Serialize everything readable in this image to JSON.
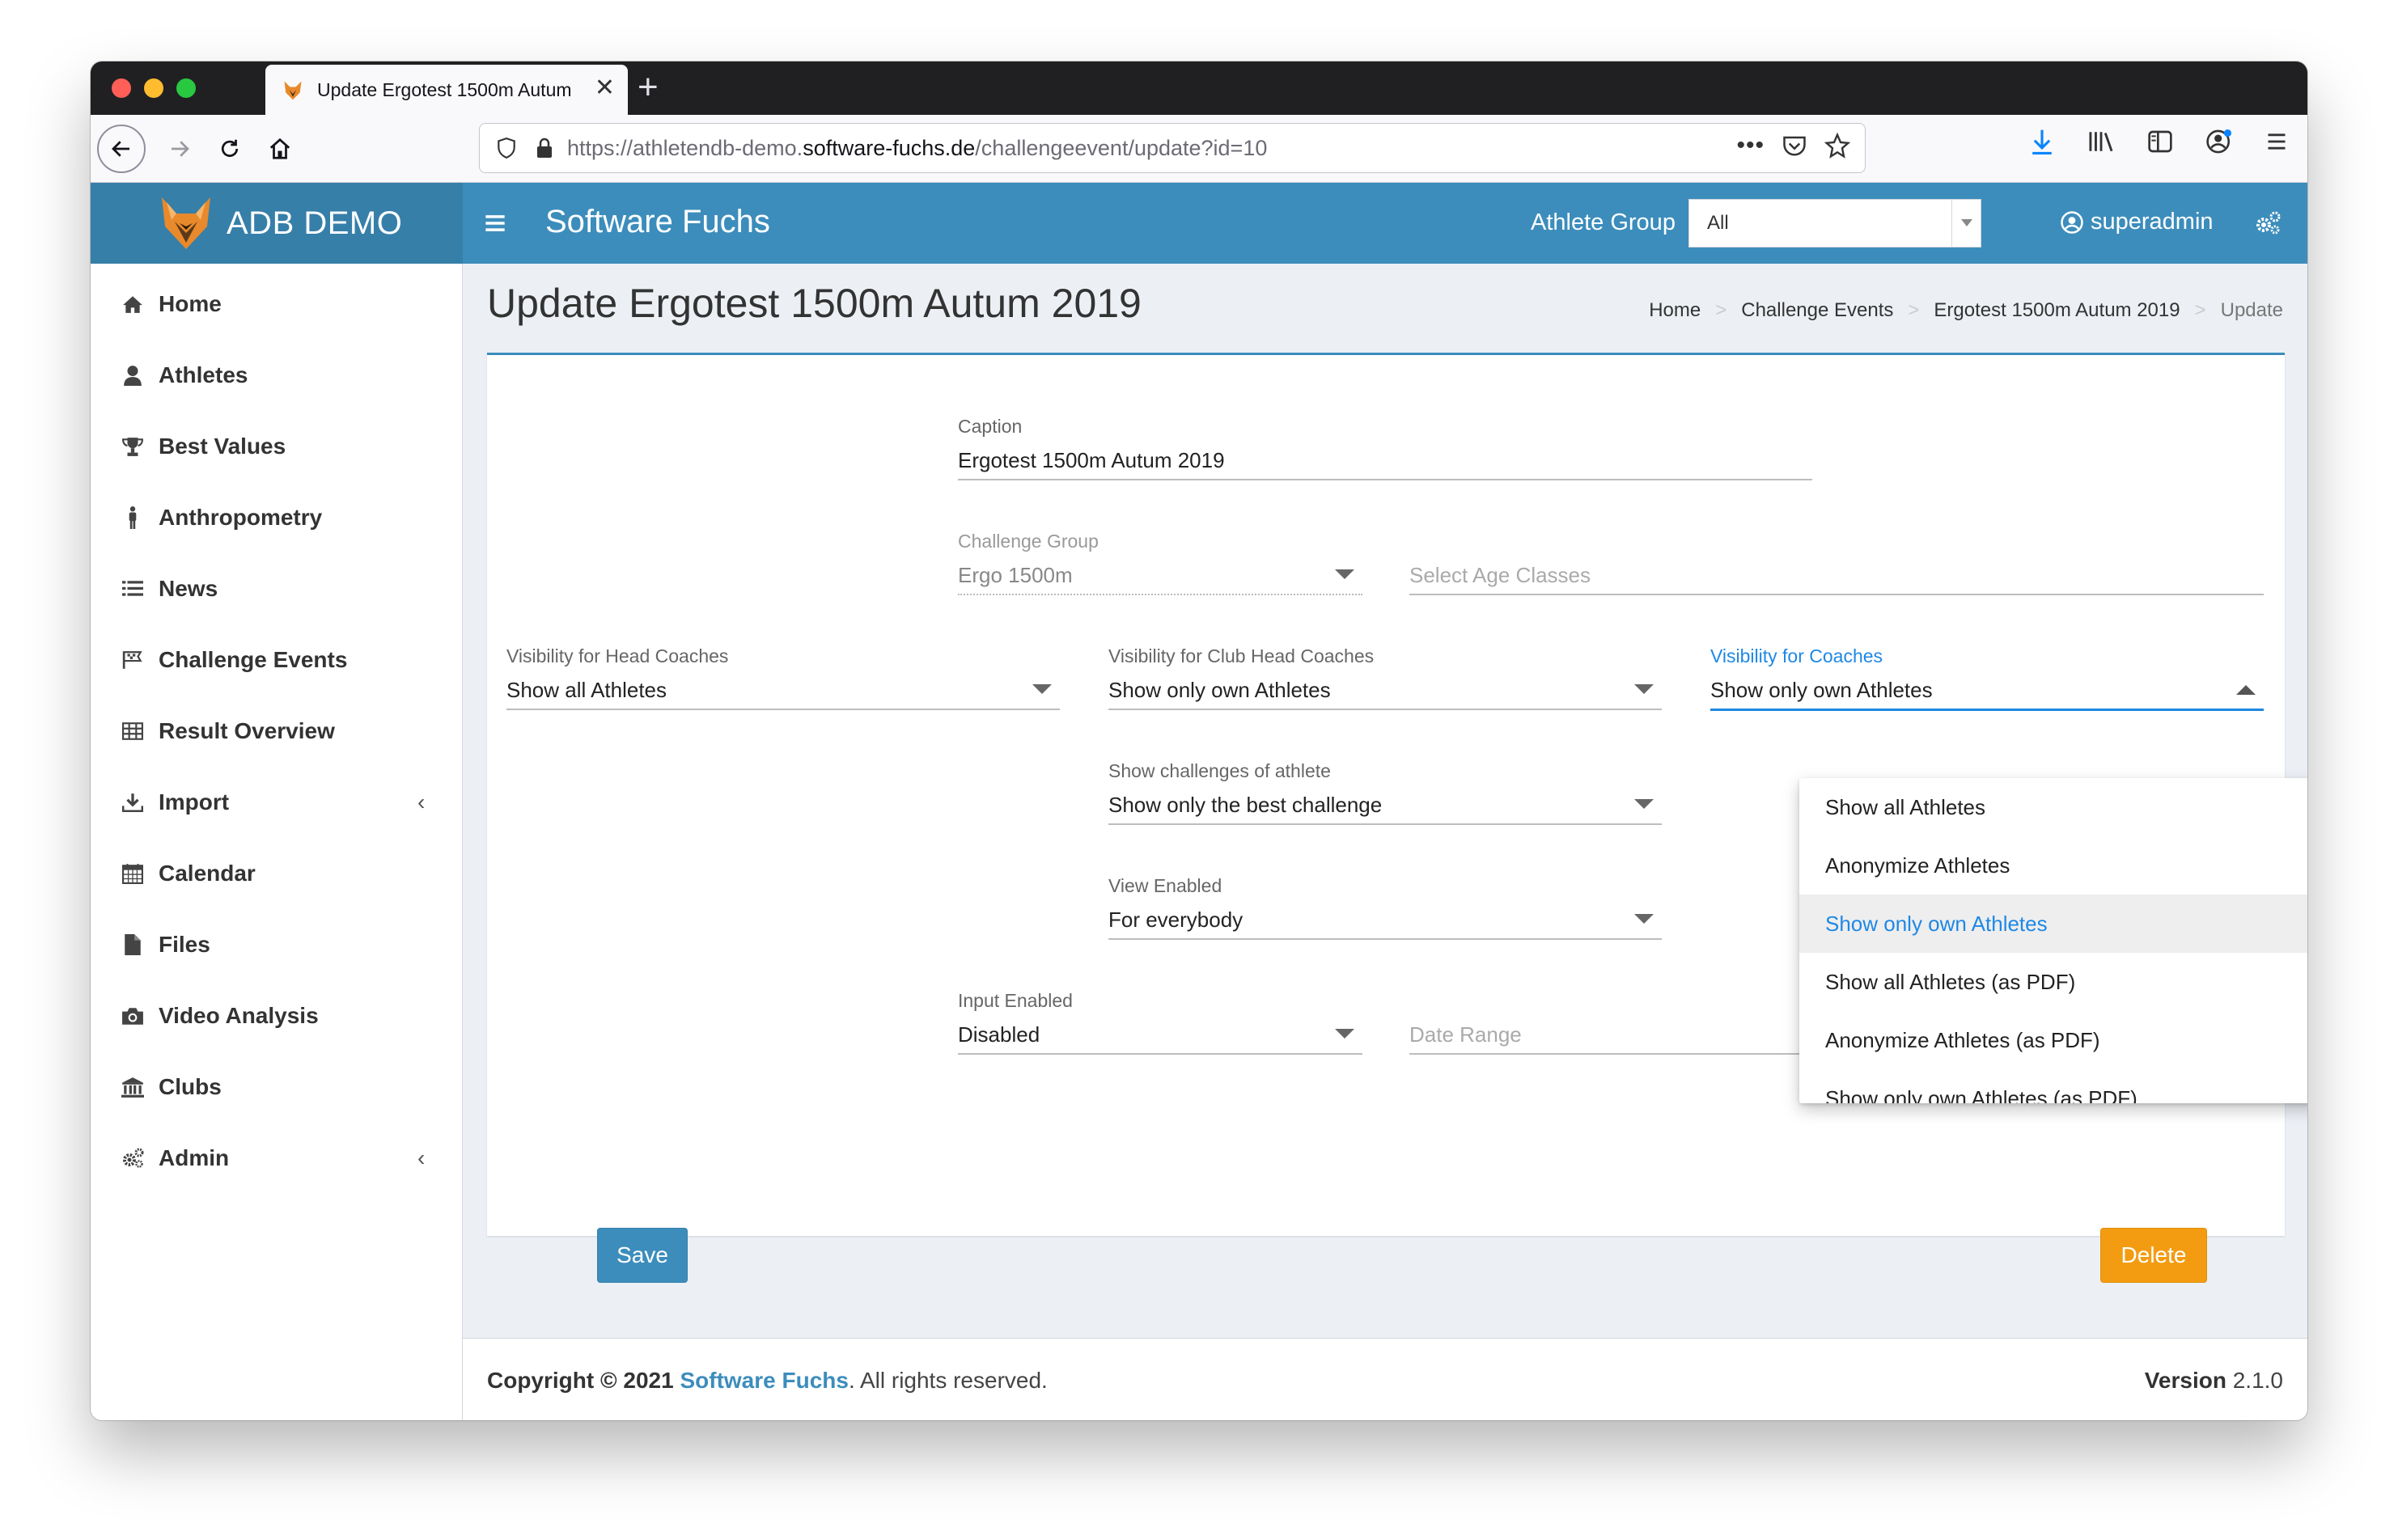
{
  "browser": {
    "tab_title": "Update Ergotest 1500m Autum",
    "url_prefix": "https://athletendb-demo.",
    "url_host": "software-fuchs.de",
    "url_path": "/challengeevent/update?id=10"
  },
  "header": {
    "brand": "ADB DEMO",
    "title": "Software Fuchs",
    "athlete_group_label": "Athlete Group",
    "athlete_group_value": "All",
    "user": "superadmin"
  },
  "sidebar": {
    "items": [
      {
        "label": "Home",
        "icon": "home-icon"
      },
      {
        "label": "Athletes",
        "icon": "user-icon"
      },
      {
        "label": "Best Values",
        "icon": "trophy-icon"
      },
      {
        "label": "Anthropometry",
        "icon": "person-icon"
      },
      {
        "label": "News",
        "icon": "list-icon"
      },
      {
        "label": "Challenge Events",
        "icon": "flag-icon"
      },
      {
        "label": "Result Overview",
        "icon": "table-icon"
      },
      {
        "label": "Import",
        "icon": "download-icon"
      },
      {
        "label": "Calendar",
        "icon": "calendar-icon"
      },
      {
        "label": "Files",
        "icon": "file-icon"
      },
      {
        "label": "Video Analysis",
        "icon": "camera-icon"
      },
      {
        "label": "Clubs",
        "icon": "bank-icon"
      },
      {
        "label": "Admin",
        "icon": "cogs-icon"
      }
    ]
  },
  "page": {
    "title": "Update Ergotest 1500m Autum 2019",
    "breadcrumb": [
      "Home",
      "Challenge Events",
      "Ergotest 1500m Autum 2019",
      "Update"
    ]
  },
  "form": {
    "caption": {
      "label": "Caption",
      "value": "Ergotest 1500m Autum 2019"
    },
    "challenge_group": {
      "label": "Challenge Group",
      "value": "Ergo 1500m"
    },
    "age_classes": {
      "placeholder": "Select Age Classes"
    },
    "vis_head_coaches": {
      "label": "Visibility for Head Coaches",
      "value": "Show all Athletes"
    },
    "vis_club_head_coaches": {
      "label": "Visibility for Club Head Coaches",
      "value": "Show only own Athletes"
    },
    "vis_coaches": {
      "label": "Visibility for Coaches",
      "value": "Show only own Athletes"
    },
    "show_challenges": {
      "label": "Show challenges of athlete",
      "value": "Show only the best challenge"
    },
    "view_enabled": {
      "label": "View Enabled",
      "value": "For everybody"
    },
    "input_enabled": {
      "label": "Input Enabled",
      "value": "Disabled"
    },
    "date_range": {
      "placeholder": "Date Range"
    },
    "dropdown_options": [
      "Show all Athletes",
      "Anonymize Athletes",
      "Show only own Athletes",
      "Show all Athletes (as PDF)",
      "Anonymize Athletes (as PDF)",
      "Show only own Athletes (as PDF)"
    ],
    "save_label": "Save",
    "delete_label": "Delete"
  },
  "footer": {
    "copyright_prefix": "Copyright © 2021",
    "company": "Software Fuchs",
    "rights": ". All rights reserved.",
    "version_label": "Version",
    "version_value": "2.1.0"
  },
  "colors": {
    "header": "#3c8dbc",
    "brand": "#367fa9",
    "accent": "#1e88e5",
    "delete": "#f39c12"
  }
}
